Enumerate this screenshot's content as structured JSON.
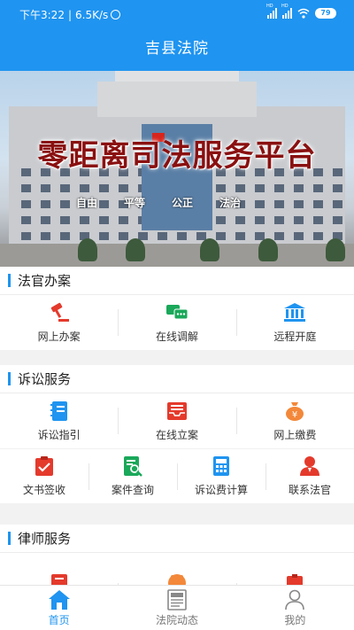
{
  "status_bar": {
    "time": "下午3:22",
    "speed": "6.5K/s",
    "network_label": "HD",
    "battery": "79"
  },
  "header": {
    "title": "吉县法院"
  },
  "banner": {
    "slogan": "零距离司法服务平台",
    "values": [
      "自由",
      "平等",
      "公正",
      "法治"
    ]
  },
  "sections": {
    "judge": {
      "title": "法官办案",
      "items": [
        {
          "label": "网上办案",
          "icon": "gavel-icon"
        },
        {
          "label": "在线调解",
          "icon": "chat-icon"
        },
        {
          "label": "远程开庭",
          "icon": "courthouse-icon"
        }
      ]
    },
    "litigation": {
      "title": "诉讼服务",
      "items": [
        {
          "label": "诉讼指引",
          "icon": "notebook-icon"
        },
        {
          "label": "在线立案",
          "icon": "inbox-icon"
        },
        {
          "label": "网上缴费",
          "icon": "money-bag-icon"
        }
      ],
      "items2": [
        {
          "label": "文书签收",
          "icon": "clipboard-check-icon"
        },
        {
          "label": "案件查询",
          "icon": "document-search-icon"
        },
        {
          "label": "诉讼费计算",
          "icon": "calculator-icon"
        },
        {
          "label": "联系法官",
          "icon": "judge-icon"
        }
      ]
    },
    "lawyer": {
      "title": "律师服务"
    }
  },
  "nav": {
    "items": [
      {
        "label": "首页",
        "icon": "home-icon"
      },
      {
        "label": "法院动态",
        "icon": "news-icon"
      },
      {
        "label": "我的",
        "icon": "user-icon"
      }
    ],
    "active_index": 0
  },
  "colors": {
    "primary": "#1f94f0",
    "red": "#e43a2c",
    "green": "#1aa85a",
    "orange": "#f3883a"
  }
}
